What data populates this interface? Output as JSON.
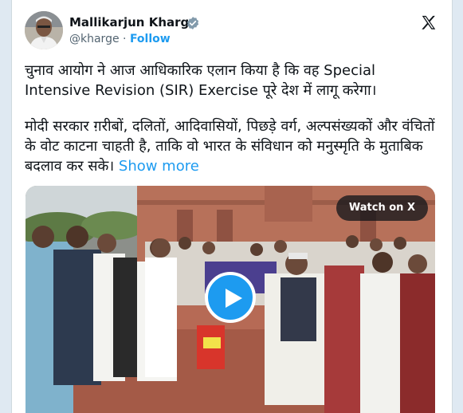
{
  "author": {
    "name": "Mallikarjun Kharge",
    "handle": "@kharge",
    "separator": "·",
    "follow_label": "Follow"
  },
  "tweet": {
    "paragraph1": "चुनाव आयोग ने आज आधिकारिक एलान किया है कि वह Special Intensive Revision (SIR) Exercise पूरे देश में लागू करेगा।",
    "paragraph2": "मोदी सरकार ग़रीबों, दलितों, आदिवासियों, पिछड़े वर्ग, अल्पसंख्यकों और वंचितों के वोट काटना चाहती है, ताकि वो भारत के संविधान को मनुस्मृति के मुताबिक बदलाव कर सके।",
    "show_more_label": "Show more"
  },
  "media": {
    "watch_label": "Watch on X",
    "icon": "play-icon"
  },
  "icons": {
    "verified": "verified-badge-icon",
    "logo": "x-logo-icon"
  },
  "colors": {
    "accent": "#1d9bf0",
    "text": "#0f1419",
    "muted": "#536471",
    "background": "#dfe9f2"
  }
}
